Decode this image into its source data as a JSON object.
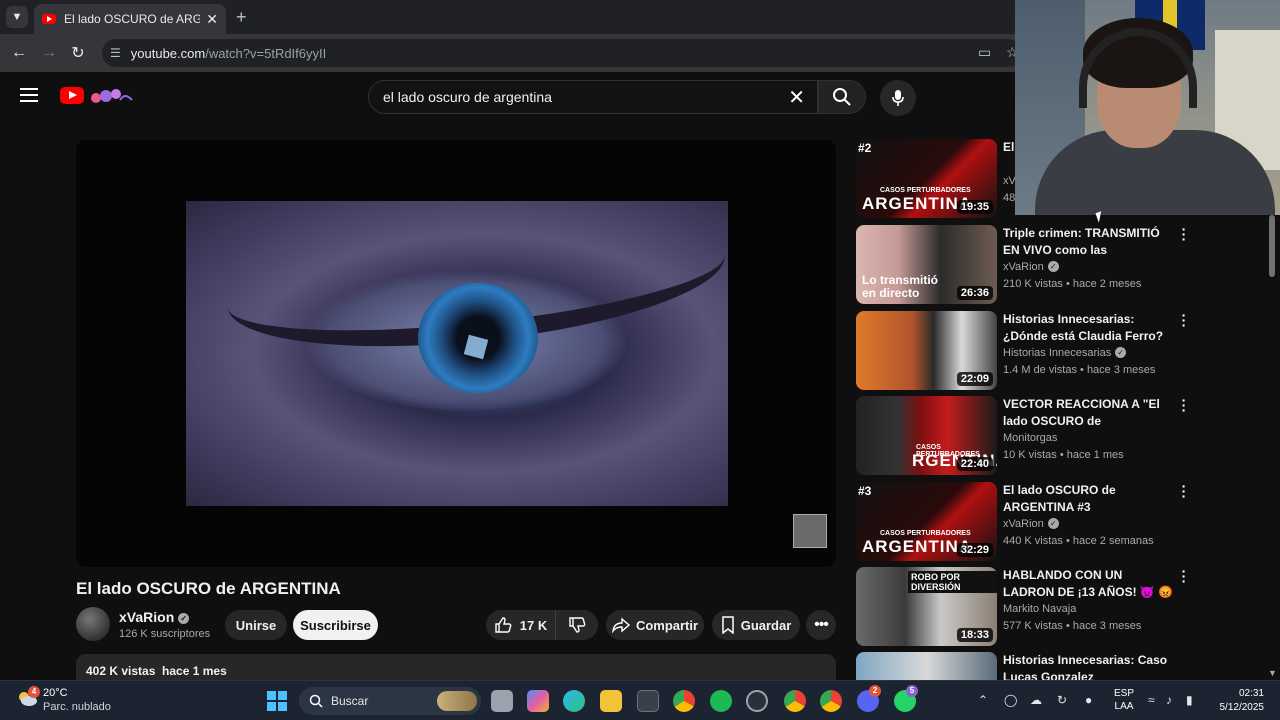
{
  "browser": {
    "tab_title": "El lado OSCURO de ARGENTINA",
    "url_host": "youtube.com",
    "url_path": "/watch?v=5tRdIf6yyII"
  },
  "header": {
    "search_query": "el lado oscuro de argentina"
  },
  "video": {
    "title": "El lado OSCURO de ARGENTINA",
    "channel": "xVaRion",
    "subscribers": "126 K suscriptores",
    "join_label": "Unirse",
    "subscribe_label": "Suscribirse",
    "likes": "17 K",
    "share_label": "Compartir",
    "save_label": "Guardar",
    "views_date": "402 K vistas  hace 1 mes"
  },
  "recommendations": [
    {
      "rank": "#2",
      "title": "El #2",
      "channel": "xV",
      "meta": "48",
      "duration": "19:35",
      "caption": "ARGENTINA",
      "small": "CASOS PERTURBADORES"
    },
    {
      "rank": "",
      "title": "Triple crimen: TRANSMITIÓ EN VIVO como las TØRTURABA | ...",
      "channel": "xVaRion",
      "meta": "210 K vistas • hace 2 meses",
      "duration": "26:36",
      "caption": "Lo transmitió en directo",
      "small": ""
    },
    {
      "rank": "",
      "title": "Historias Innecesarias: ¿Dónde está Claudia Ferro?",
      "channel": "Historias Innecesarias",
      "meta": "1.4 M de vistas • hace 3 meses",
      "duration": "22:09",
      "caption": "",
      "small": ""
    },
    {
      "rank": "",
      "title": "VECTOR REACCIONA A \"El lado OSCURO de ARGENTINA\" // ...",
      "channel": "Monitorgas",
      "meta": "10 K vistas • hace 1 mes",
      "duration": "22:40",
      "caption": "RGENTINA",
      "small": "CASOS PERTURBADORES"
    },
    {
      "rank": "#3",
      "title": "El lado OSCURO de ARGENTINA #3",
      "channel": "xVaRion",
      "meta": "440 K vistas • hace 2 semanas",
      "duration": "32:29",
      "caption": "ARGENTINA",
      "small": "CASOS PERTURBADORES"
    },
    {
      "rank": "",
      "title": "HABLANDO CON UN LADRON DE ¡13 AÑOS! 👿 😡",
      "channel": "Markito Navaja",
      "meta": "577 K vistas • hace 3 meses",
      "duration": "18:33",
      "caption": "",
      "small": "ROBO POR DIVERSIÓN"
    },
    {
      "rank": "",
      "title": "Historias Innecesarias: Caso Lucas Gonzalez",
      "channel": "",
      "meta": "",
      "duration": "",
      "caption": "",
      "small": ""
    }
  ],
  "taskbar": {
    "weather_temp": "20°C",
    "weather_desc": "Parc. nublado",
    "weather_badge": "4",
    "search_label": "Buscar",
    "lang_line1": "ESP",
    "lang_line2": "LAA",
    "time": "02:31",
    "date": "5/12/2025",
    "discord_badge": "2",
    "whatsapp_badge": "5"
  },
  "colors": {
    "youtube_red": "#ff0000",
    "background": "#0f0f0f",
    "pill": "#272727"
  }
}
